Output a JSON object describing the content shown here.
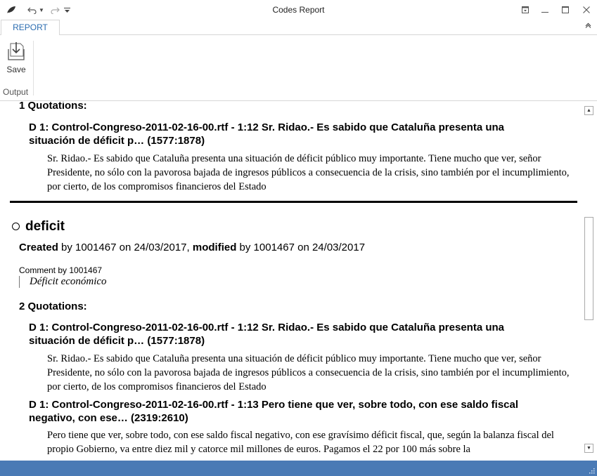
{
  "window": {
    "title": "Codes Report",
    "icons": [
      "app-leaf-icon",
      "undo-icon",
      "undo-dropdown-icon",
      "redo-icon",
      "quick-access-customize-icon"
    ]
  },
  "ribbon": {
    "tabs": [
      {
        "label": "REPORT",
        "active": true
      }
    ],
    "save_label": "Save",
    "group_label": "Output"
  },
  "report": {
    "section1": {
      "quotations_label": "1 Quotations:",
      "quotations": [
        {
          "heading": "D 1: Control-Congreso-2011-02-16-00.rtf - 1:12 Sr. Ridao.- Es sabido que Cataluña presenta una situación de déficit p… (1577:1878)",
          "body": "Sr. Ridao.- Es sabido que Cataluña presenta una situación de déficit público muy importante. Tiene mucho que ver, señor Presidente, no sólo con la pavorosa bajada de ingresos públicos a consecuencia de la crisis, sino también por el incumplimiento, por cierto, de los compromisos financieros del Estado"
        }
      ]
    },
    "code": {
      "name": "deficit",
      "created_label": "Created",
      "created_by": " by 1001467 on 24/03/2017, ",
      "modified_label": "modified",
      "modified_by": " by 1001467 on 24/03/2017",
      "comment_by": "Comment by 1001467",
      "comment": "Déficit económico",
      "quotations_label": "2 Quotations:",
      "quotations": [
        {
          "heading": "D 1: Control-Congreso-2011-02-16-00.rtf - 1:12 Sr. Ridao.- Es sabido que Cataluña presenta una situación de déficit p… (1577:1878)",
          "body": "Sr. Ridao.- Es sabido que Cataluña presenta una situación de déficit público muy importante. Tiene mucho que ver, señor Presidente, no sólo con la pavorosa bajada de ingresos públicos a consecuencia de la crisis, sino también por el incumplimiento, por cierto, de los compromisos financieros del Estado"
        },
        {
          "heading": "D 1: Control-Congreso-2011-02-16-00.rtf - 1:13 Pero tiene que ver, sobre todo, con ese saldo fiscal negativo, con ese… (2319:2610)",
          "body": "Pero tiene que ver, sobre todo, con ese saldo fiscal negativo, con ese gravísimo déficit fiscal, que, según la balanza fiscal del propio Gobierno, va entre diez mil y catorce mil millones de euros. Pagamos el 22 por 100 más sobre la"
        }
      ]
    }
  },
  "colors": {
    "accent": "#2b6cb0",
    "statusbar": "#4a7ab5"
  }
}
